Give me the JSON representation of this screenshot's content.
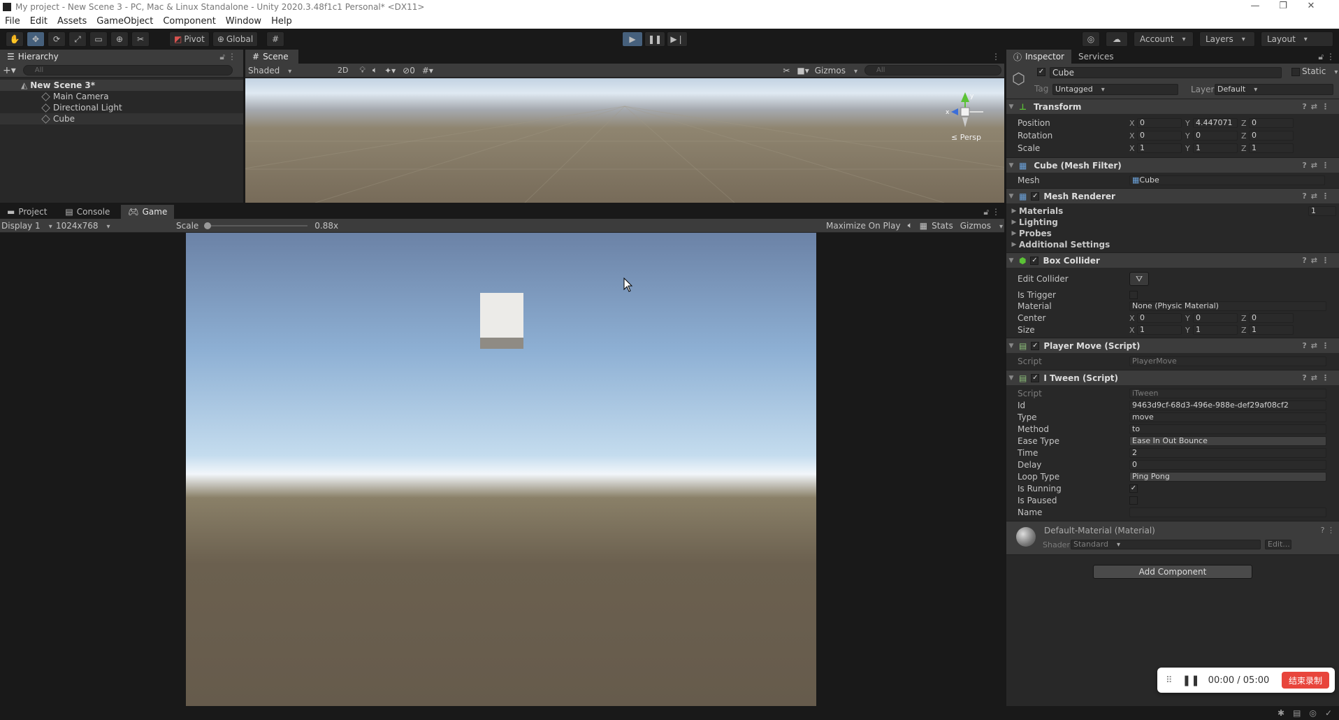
{
  "window": {
    "title": "My project - New Scene 3 - PC, Mac & Linux Standalone - Unity 2020.3.48f1c1 Personal* <DX11>"
  },
  "menu": [
    "File",
    "Edit",
    "Assets",
    "GameObject",
    "Component",
    "Window",
    "Help"
  ],
  "toolbar": {
    "pivot": "Pivot",
    "global": "Global",
    "account": "Account",
    "layers": "Layers",
    "layout": "Layout"
  },
  "hierarchy": {
    "tab": "Hierarchy",
    "search_placeholder": "All",
    "scene": "New Scene 3*",
    "items": [
      "Main Camera",
      "Directional Light",
      "Cube"
    ]
  },
  "scene": {
    "tab": "Scene",
    "shading": "Shaded",
    "mode2d": "2D",
    "hidden_count": "0",
    "gizmos": "Gizmos",
    "search_placeholder": "All",
    "persp": "Persp",
    "axis_x": "x",
    "axis_y": "y"
  },
  "bottom_tabs": [
    "Project",
    "Console",
    "Game"
  ],
  "game": {
    "display": "Display 1",
    "resolution": "1024x768",
    "scale_label": "Scale",
    "scale_value": "0.88x",
    "maximize": "Maximize On Play",
    "stats": "Stats",
    "gizmos": "Gizmos"
  },
  "inspector": {
    "tabs": [
      "Inspector",
      "Services"
    ],
    "object_name": "Cube",
    "static_label": "Static",
    "tag_label": "Tag",
    "tag_value": "Untagged",
    "layer_label": "Layer",
    "layer_value": "Default",
    "transform": {
      "title": "Transform",
      "position": {
        "label": "Position",
        "x": "0",
        "y": "4.447071",
        "z": "0"
      },
      "rotation": {
        "label": "Rotation",
        "x": "0",
        "y": "0",
        "z": "0"
      },
      "scale": {
        "label": "Scale",
        "x": "1",
        "y": "1",
        "z": "1"
      }
    },
    "mesh_filter": {
      "title": "Cube (Mesh Filter)",
      "mesh_label": "Mesh",
      "mesh_value": "Cube"
    },
    "mesh_renderer": {
      "title": "Mesh Renderer",
      "materials": "Materials",
      "materials_count": "1",
      "lighting": "Lighting",
      "probes": "Probes",
      "additional": "Additional Settings"
    },
    "box_collider": {
      "title": "Box Collider",
      "edit_collider": "Edit Collider",
      "is_trigger": "Is Trigger",
      "material_label": "Material",
      "material_value": "None (Physic Material)",
      "center": {
        "label": "Center",
        "x": "0",
        "y": "0",
        "z": "0"
      },
      "size": {
        "label": "Size",
        "x": "1",
        "y": "1",
        "z": "1"
      }
    },
    "player_move": {
      "title": "Player Move (Script)",
      "script_label": "Script",
      "script_value": "PlayerMove"
    },
    "itween": {
      "title": "I Tween (Script)",
      "script_label": "Script",
      "script_value": "iTween",
      "fields": [
        {
          "label": "Id",
          "value": "9463d9cf-68d3-496e-988e-def29af08cf2"
        },
        {
          "label": "Type",
          "value": "move"
        },
        {
          "label": "Method",
          "value": "to"
        },
        {
          "label": "Ease Type",
          "value": "Ease In Out Bounce"
        },
        {
          "label": "Time",
          "value": "2"
        },
        {
          "label": "Delay",
          "value": "0"
        },
        {
          "label": "Loop Type",
          "value": "Ping Pong"
        }
      ],
      "is_running": "Is Running",
      "is_paused": "Is Paused",
      "name_label": "Name"
    },
    "material": {
      "title": "Default-Material (Material)",
      "shader_label": "Shader",
      "shader_value": "Standard",
      "edit": "Edit..."
    },
    "add_component": "Add Component"
  },
  "recorder": {
    "time": "00:00 / 05:00",
    "stop_label": "结束录制",
    "stop_color": "#e8453c"
  },
  "icons": [
    "hand-icon",
    "move-icon",
    "rotate-icon",
    "scale-icon",
    "rect-icon",
    "transform-icon",
    "custom-tool-icon",
    "play-icon",
    "pause-icon",
    "step-icon",
    "cloud-icon",
    "lock-icon",
    "kebab-icon",
    "sound-icon"
  ]
}
